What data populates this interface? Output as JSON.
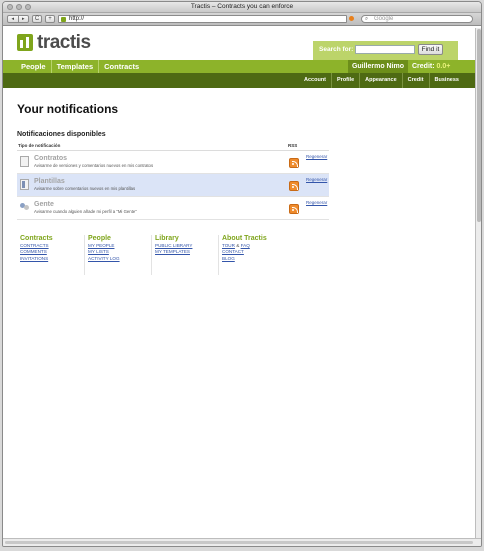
{
  "browser": {
    "window_title": "Tractis – Contracts you can enforce",
    "back_label": "◂",
    "forward_label": "▸",
    "reload_label": "C",
    "add_label": "+",
    "url": "http://",
    "search_placeholder": "Google"
  },
  "site": {
    "logo_text": "tractis",
    "search_label": "Search for:",
    "search_value": "",
    "search_button": "Find it",
    "brand_color": "#8db32a",
    "dark_color": "#4e6a13"
  },
  "main_nav": {
    "items": [
      {
        "label": "People"
      },
      {
        "label": "Templates"
      },
      {
        "label": "Contracts"
      }
    ],
    "user_name": "Guillermo Nimo",
    "credit_label": "Credit:",
    "credit_amount": "0.0+"
  },
  "sub_nav": {
    "items": [
      {
        "label": "Account"
      },
      {
        "label": "Profile"
      },
      {
        "label": "Appearance"
      },
      {
        "label": "Credit"
      },
      {
        "label": "Business"
      }
    ]
  },
  "page": {
    "title": "Your notifications",
    "section_title": "Notificaciones disponibles",
    "col_type": "Tipo de notificación",
    "col_rss": "RSS",
    "notifications": [
      {
        "name": "Contratos",
        "description": "Avisarme de versiones y comentarios nuevos en mis contratos",
        "action": "Regenerar"
      },
      {
        "name": "Plantillas",
        "description": "Avisarme sobre comentarios nuevos en mis plantillas",
        "action": "Regenerar"
      },
      {
        "name": "Gente",
        "description": "Avisarme cuando alguien añade mi perfil a \"Mi Gente\"",
        "action": "Regenerar"
      }
    ]
  },
  "footer": {
    "contracts": {
      "heading": "Contracts",
      "links": [
        "CONTRACTS",
        "COMMENTS",
        "INVITATIONS"
      ]
    },
    "people": {
      "heading": "People",
      "links": [
        "MY PEOPLE",
        "MY LISTS",
        "ACTIVITY LOG"
      ]
    },
    "library": {
      "heading": "Library",
      "links": [
        "PUBLIC LIBRARY",
        "MY TEMPLATES"
      ]
    },
    "about": {
      "heading": "About Tractis",
      "tour": "TOUR",
      "amp": "&",
      "faq": "FAQ",
      "links": [
        "CONTACT",
        "BLOG"
      ]
    }
  }
}
